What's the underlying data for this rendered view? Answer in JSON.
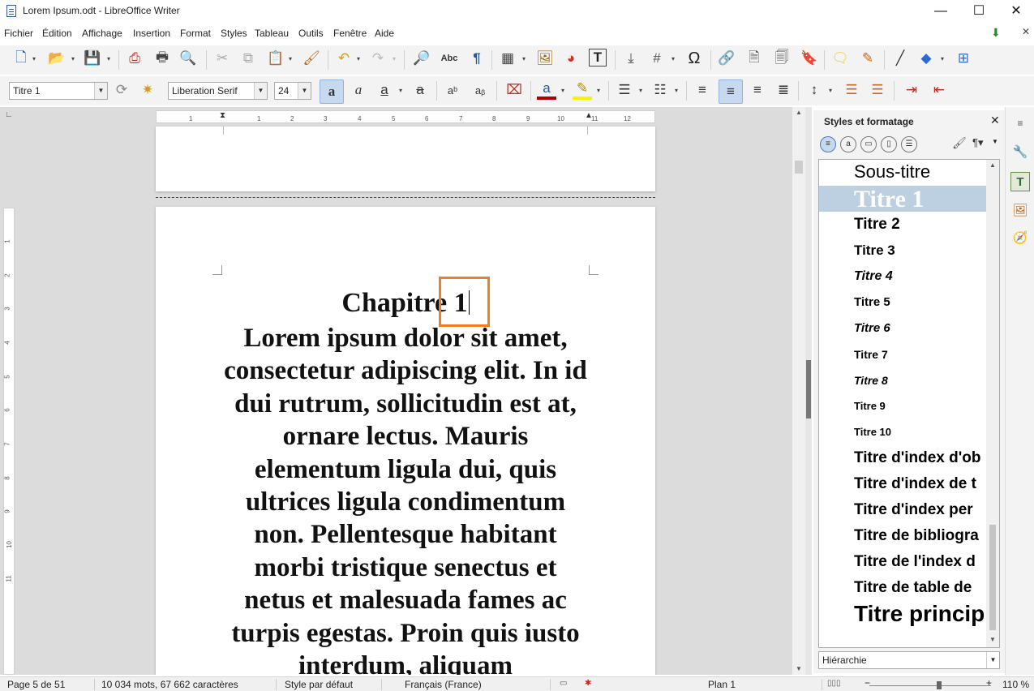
{
  "window": {
    "title": "Lorem Ipsum.odt - LibreOffice Writer",
    "minimize": "—",
    "maximize": "☐",
    "close": "✕"
  },
  "menu": [
    "Fichier",
    "Édition",
    "Affichage",
    "Insertion",
    "Format",
    "Styles",
    "Tableau",
    "Outils",
    "Fenêtre",
    "Aide"
  ],
  "formatting": {
    "paragraph_style": "Titre 1",
    "font_name": "Liberation Serif",
    "font_size": "24"
  },
  "ruler": {
    "marks": [
      "1",
      "1",
      "2",
      "3",
      "4",
      "5",
      "6",
      "7",
      "8",
      "9",
      "10",
      "11",
      "12"
    ],
    "vmarks": [
      "1",
      "2",
      "3",
      "4",
      "5",
      "6",
      "7",
      "8",
      "9",
      "10",
      "11"
    ]
  },
  "document": {
    "heading": "Chapitre 1",
    "body": "Lorem ipsum dolor sit amet, consectetur adipiscing elit. In id dui rutrum, sollicitudin est at, ornare lectus. Mauris elementum ligula dui, quis ultrices ligula condimentum non. Pellentesque habitant morbi tristique senectus et netus et malesuada fames ac turpis egestas. Proin quis iusto interdum, aliquam"
  },
  "sidebar": {
    "title": "Styles et formatage",
    "close": "✕",
    "styles": [
      {
        "name": "Sous-titre"
      },
      {
        "name": "Titre 1"
      },
      {
        "name": "Titre 2"
      },
      {
        "name": "Titre 3"
      },
      {
        "name": "Titre 4"
      },
      {
        "name": "Titre 5"
      },
      {
        "name": "Titre 6"
      },
      {
        "name": "Titre 7"
      },
      {
        "name": "Titre 8"
      },
      {
        "name": "Titre 9"
      },
      {
        "name": "Titre 10"
      },
      {
        "name": "Titre d'index d'ob"
      },
      {
        "name": "Titre d'index de t"
      },
      {
        "name": "Titre d'index per"
      },
      {
        "name": "Titre de bibliogra"
      },
      {
        "name": "Titre de l'index d"
      },
      {
        "name": "Titre de table de"
      },
      {
        "name": "Titre princip"
      }
    ],
    "filter": "Hiérarchie"
  },
  "statusbar": {
    "page": "Page 5 de 51",
    "words": "10 034 mots, 67 662 caractères",
    "page_style": "Style par défaut",
    "language": "Français (France)",
    "outline": "Plan 1",
    "zoom": "110 %"
  },
  "colors": {
    "highlight_box": "#f07f20",
    "selected_style": "#bcd0e2",
    "page_break": "#3333cc"
  }
}
